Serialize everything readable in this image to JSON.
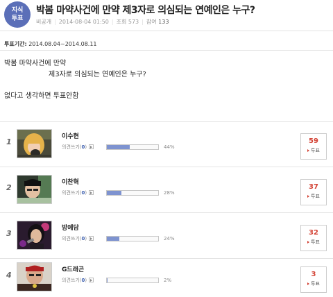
{
  "header": {
    "badge_line1": "지식",
    "badge_line2": "투표",
    "title": "박봄 마약사건에 만약 제3자로 의심되는 연예인은 누구?",
    "visibility": "비공개",
    "datetime": "2014-08-04 01:50",
    "views_label": "조회",
    "views": "573",
    "participants_label": "참여",
    "participants": "133"
  },
  "period": {
    "label": "투표기간:",
    "value": "2014.08.04~2014.08.11"
  },
  "question": {
    "line1": "박봄 마약사건에 만약",
    "line2": "제3자로 의심되는 연예인은 누구?",
    "line3": "없다고 생각하면 투표안함"
  },
  "candidates": [
    {
      "rank": "1",
      "name": "이수현",
      "comment_label": "의견쓰기",
      "comment_count": "0",
      "percent": "44%",
      "percent_value": 44,
      "votes": "59",
      "vote_label": "투표",
      "photo": "person-1-photo"
    },
    {
      "rank": "2",
      "name": "이찬혁",
      "comment_label": "의견쓰기",
      "comment_count": "0",
      "percent": "28%",
      "percent_value": 28,
      "votes": "37",
      "vote_label": "투표",
      "photo": "person-2-photo"
    },
    {
      "rank": "3",
      "name": "방예담",
      "comment_label": "의견쓰기",
      "comment_count": "0",
      "percent": "24%",
      "percent_value": 24,
      "votes": "32",
      "vote_label": "투표",
      "photo": "person-3-photo"
    },
    {
      "rank": "4",
      "name": "G드래곤",
      "comment_label": "의견쓰기",
      "comment_count": "0",
      "percent": "2%",
      "percent_value": 2,
      "votes": "3",
      "vote_label": "투표",
      "photo": "person-4-photo"
    }
  ],
  "colors": {
    "badge": "#5b6fb8",
    "bar_fill": "#7e93d0",
    "vote_count": "#d34234",
    "comment_count": "#3a5dae"
  }
}
